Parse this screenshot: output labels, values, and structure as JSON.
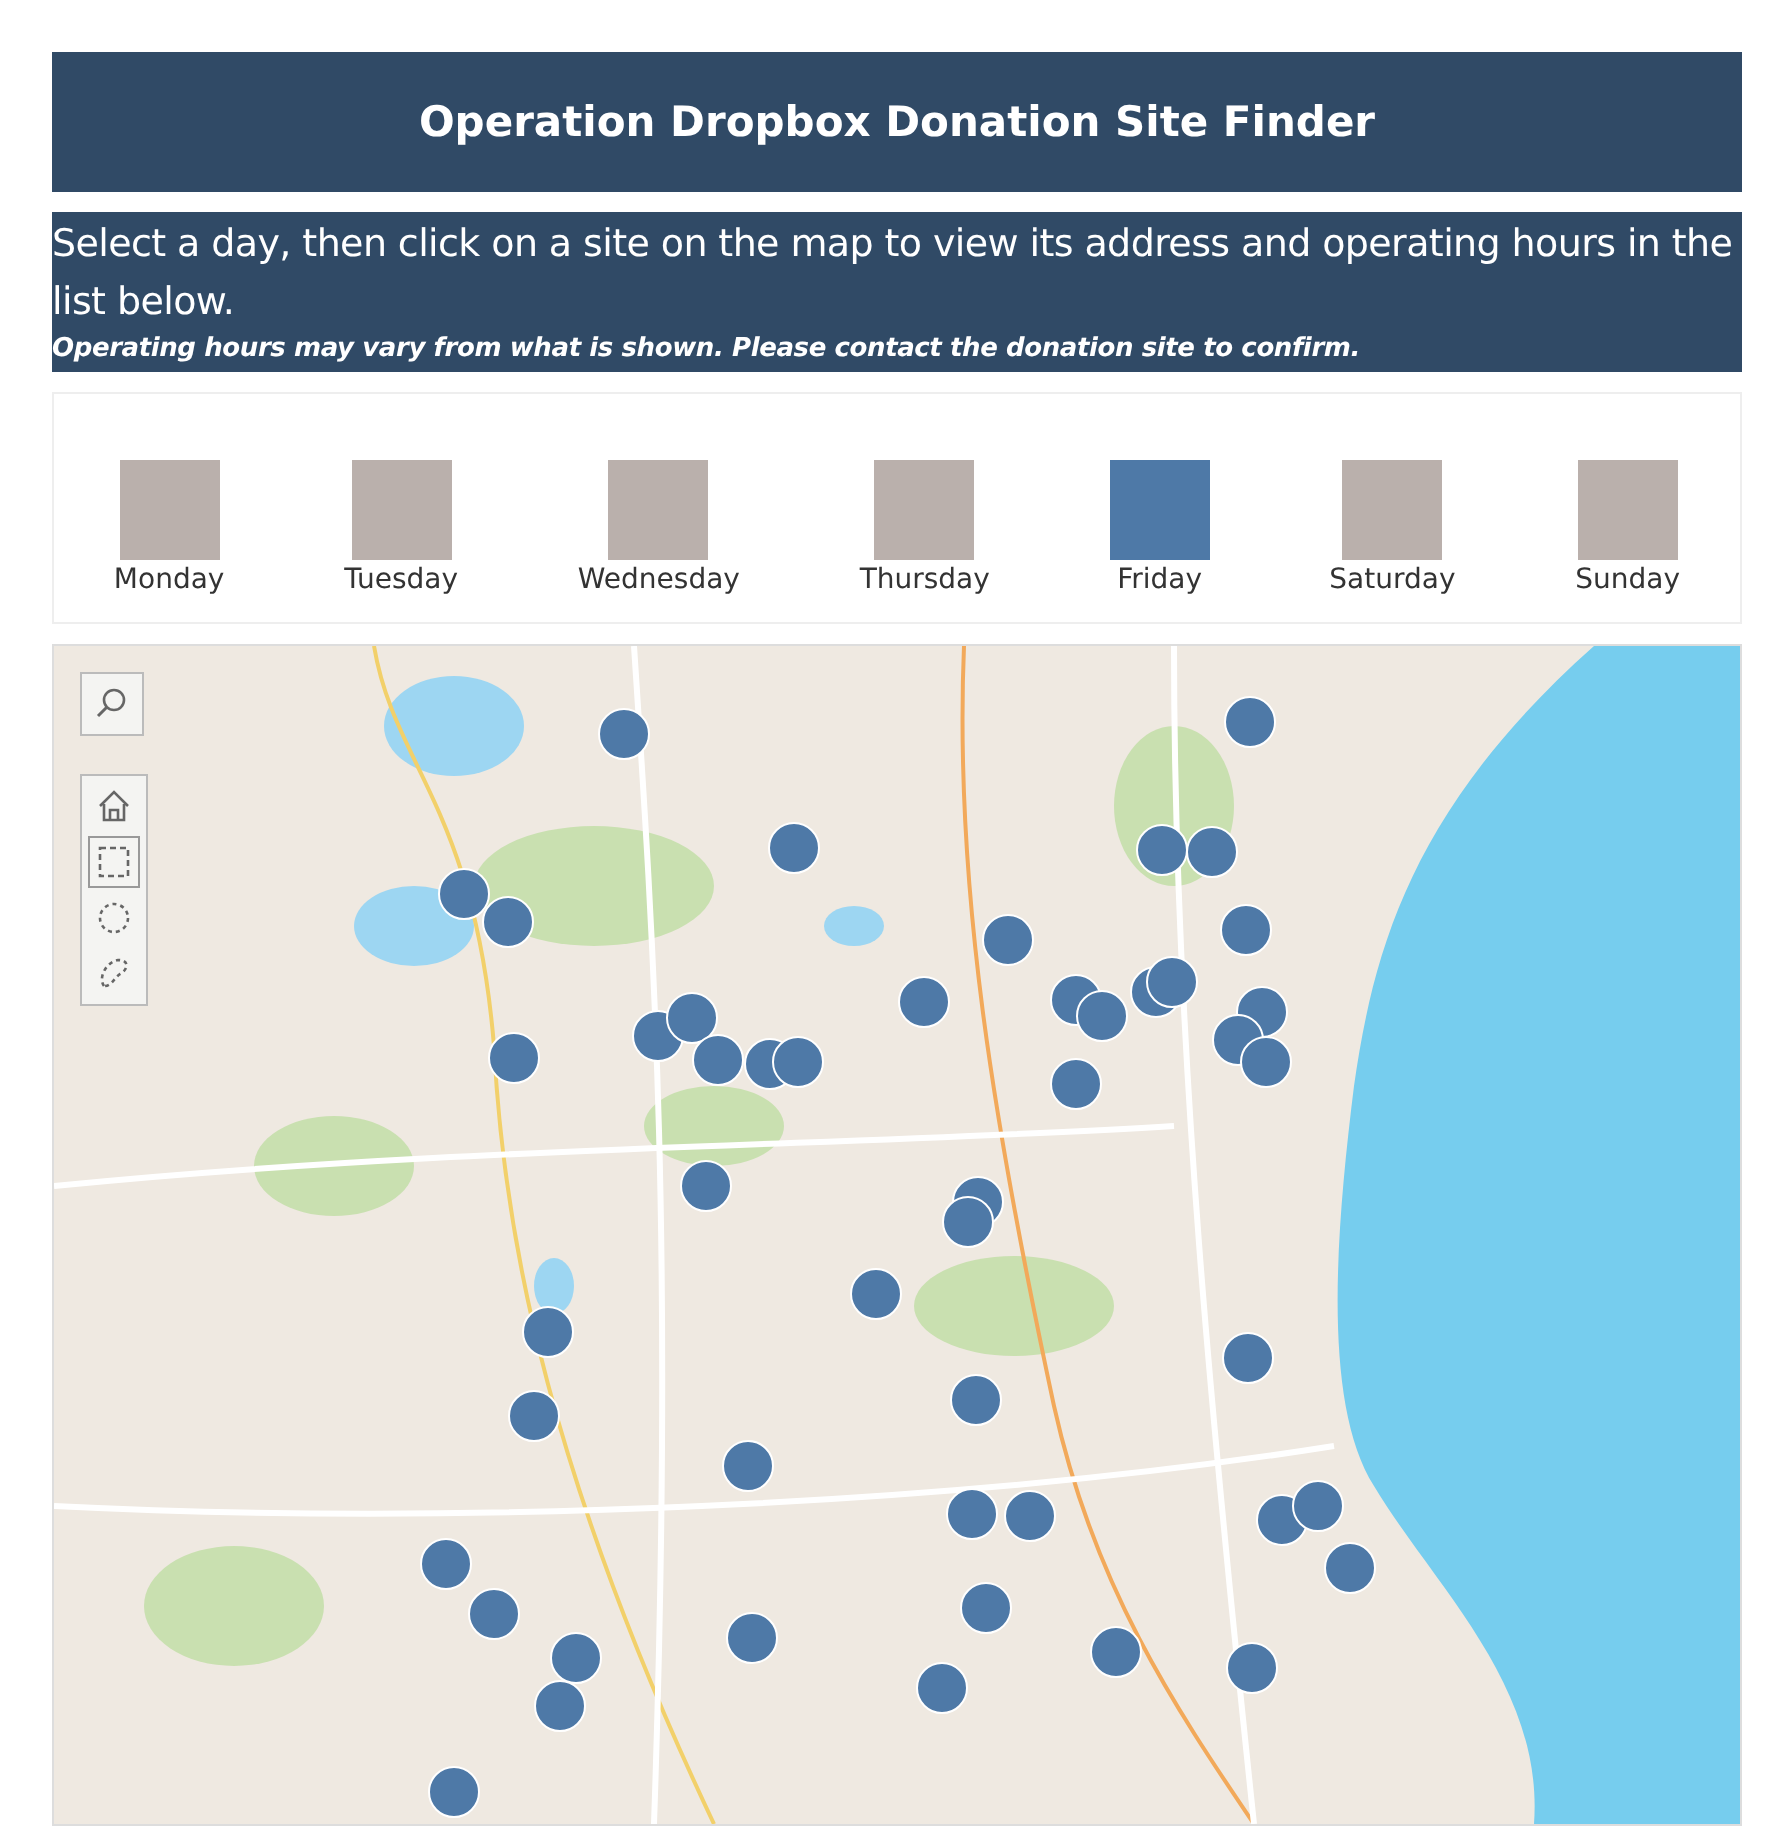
{
  "header": {
    "title": "Operation Dropbox Donation Site Finder"
  },
  "instructions": {
    "text": "Select a day, then click on a site on the map to view its address and operating hours in the list below.",
    "note": "Operating hours may vary from what is shown. Please contact the donation site to confirm."
  },
  "days": [
    {
      "label": "Monday",
      "selected": false
    },
    {
      "label": "Tuesday",
      "selected": false
    },
    {
      "label": "Wednesday",
      "selected": false
    },
    {
      "label": "Thursday",
      "selected": false
    },
    {
      "label": "Friday",
      "selected": true
    },
    {
      "label": "Saturday",
      "selected": false
    },
    {
      "label": "Sunday",
      "selected": false
    }
  ],
  "map_tools": [
    {
      "kind": "home",
      "selected": false
    },
    {
      "kind": "rect",
      "selected": true
    },
    {
      "kind": "radial",
      "selected": false
    },
    {
      "kind": "lasso",
      "selected": false
    }
  ]
}
